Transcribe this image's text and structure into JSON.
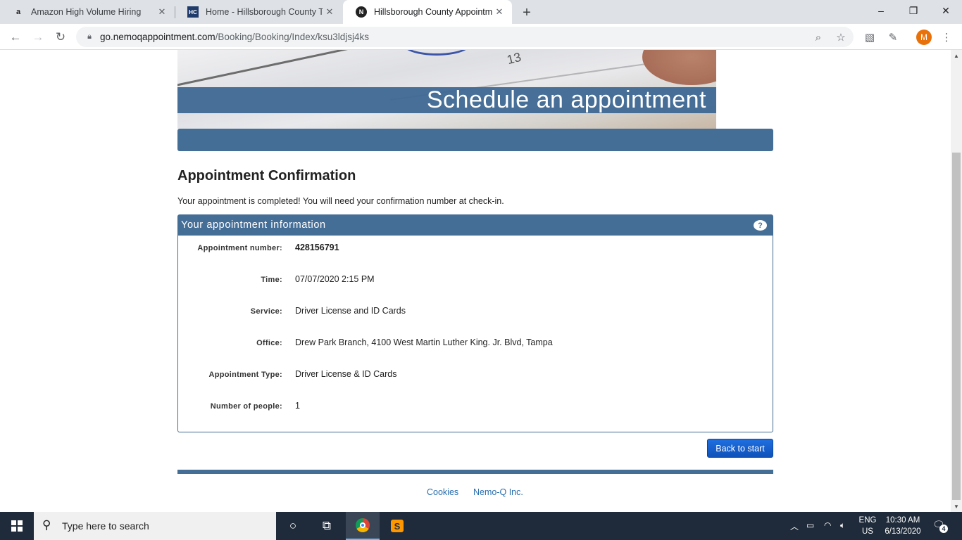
{
  "browser": {
    "tabs": [
      {
        "title": "Amazon High Volume Hiring",
        "favicon": "amazon-icon",
        "favicon_glyph": "a"
      },
      {
        "title": "Home - Hillsborough County Tax",
        "favicon": "hctax-icon",
        "favicon_glyph": "HC"
      },
      {
        "title": "Hillsborough County Appointme",
        "favicon": "nemoq-icon",
        "favicon_glyph": "N",
        "active": true
      }
    ],
    "new_tab": "+",
    "url_domain": "go.nemoqappointment.com",
    "url_path": "/Booking/Booking/Index/ksu3ldjsj4ks",
    "profile_initial": "M",
    "window_controls": {
      "minimize": "–",
      "restore": "❐",
      "close": "✕"
    }
  },
  "page": {
    "banner_text": "Schedule an appointment",
    "banner_number": "13",
    "heading": "Appointment Confirmation",
    "intro": "Your appointment is completed! You will need your confirmation number at check-in.",
    "panel": {
      "title": "Your appointment information",
      "help": "?",
      "rows": [
        {
          "label": "Appointment number:",
          "value": "428156791"
        },
        {
          "label": "Time:",
          "value": "07/07/2020 2:15 PM"
        },
        {
          "label": "Service:",
          "value": "Driver License and ID Cards"
        },
        {
          "label": "Office:",
          "value": "Drew Park Branch, 4100 West Martin Luther King. Jr. Blvd, Tampa"
        },
        {
          "label": "Appointment Type:",
          "value": "Driver License & ID Cards"
        },
        {
          "label": "Number of people:",
          "value": "1"
        }
      ]
    },
    "back_button": "Back to start",
    "footer_links": [
      "Cookies",
      "Nemo-Q Inc."
    ]
  },
  "taskbar": {
    "search_placeholder": "Type here to search",
    "lang_top": "ENG",
    "lang_bottom": "US",
    "time": "10:30 AM",
    "date": "6/13/2020",
    "notification_count": "4"
  },
  "colors": {
    "accent_blue": "#456e97",
    "button_blue": "#1560d0",
    "link_blue": "#2a6fad",
    "taskbar": "#1f2b3a"
  }
}
